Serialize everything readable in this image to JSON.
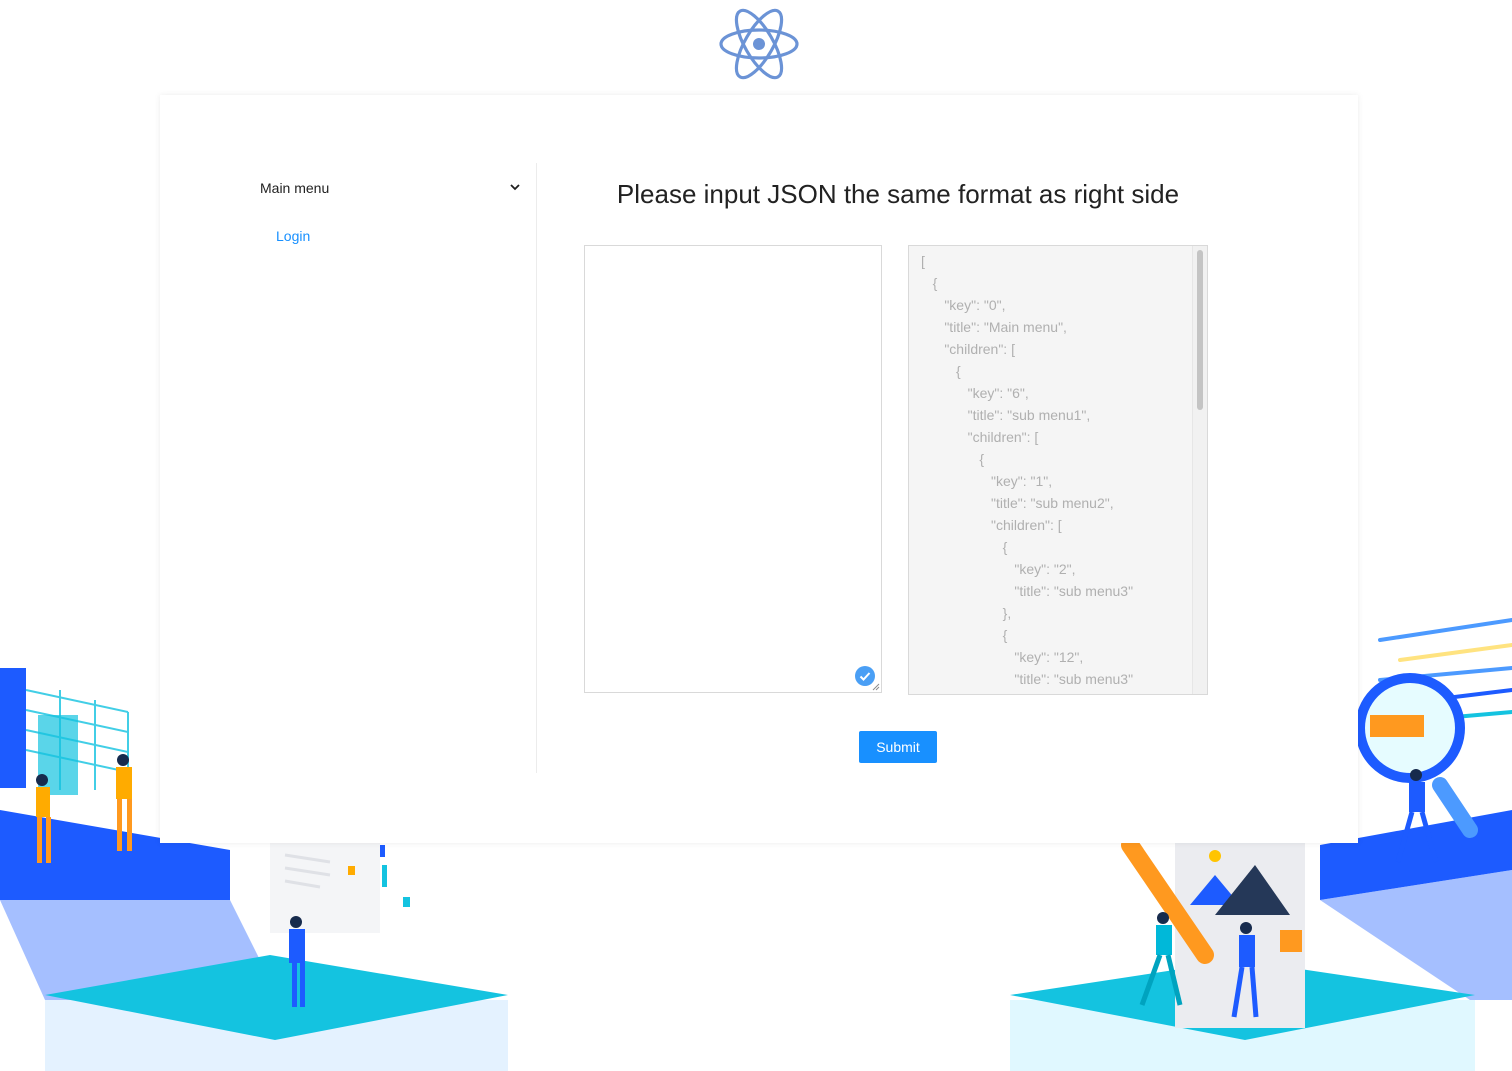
{
  "colors": {
    "primary": "#1890ff",
    "illustration_blue": "#1d5bff",
    "illustration_cyan": "#14c3e0",
    "illustration_orange": "#ffab00"
  },
  "header": {
    "logo_icon": "react-atom-icon"
  },
  "sidebar": {
    "submenu_title": "Main menu",
    "submenu_icon": "chevron-down-icon",
    "items": [
      {
        "label": "Login"
      }
    ]
  },
  "main": {
    "heading": "Please input JSON the same format as right side",
    "input_value": "",
    "input_status_icon": "check-circle-icon",
    "sample_json": "[\n   {\n      \"key\": \"0\",\n      \"title\": \"Main menu\",\n      \"children\": [\n         {\n            \"key\": \"6\",\n            \"title\": \"sub menu1\",\n            \"children\": [\n               {\n                  \"key\": \"1\",\n                  \"title\": \"sub menu2\",\n                  \"children\": [\n                     {\n                        \"key\": \"2\",\n                        \"title\": \"sub menu3\"\n                     },\n                     {\n                        \"key\": \"12\",\n                        \"title\": \"sub menu3\"",
    "submit_label": "Submit"
  }
}
